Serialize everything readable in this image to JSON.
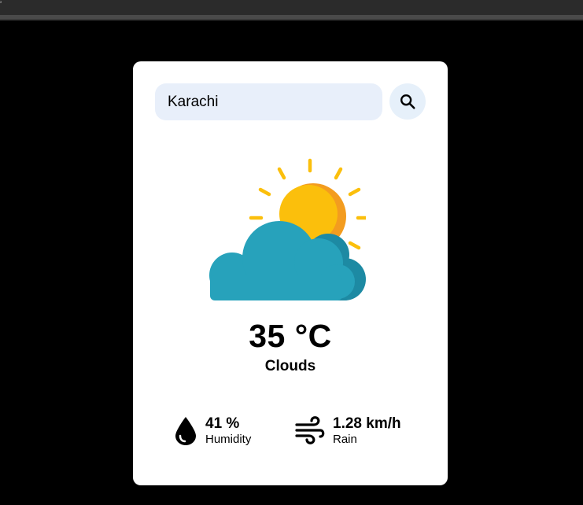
{
  "search": {
    "value": "Karachi",
    "icon": "search-icon"
  },
  "weather": {
    "icon": "sun-behind-cloud-icon",
    "temperature": "35 °C",
    "condition": "Clouds"
  },
  "details": {
    "humidity": {
      "icon": "water-drop-icon",
      "value": "41 %",
      "label": "Humidity"
    },
    "wind": {
      "icon": "wind-icon",
      "value": "1.28 km/h",
      "label": "Rain"
    }
  },
  "colors": {
    "page_background": "#000000",
    "card_background": "#ffffff",
    "search_background": "#e8effa",
    "sun": "#fbbf0c",
    "sun_shade": "#f39c1f",
    "cloud": "#27a2bb",
    "cloud_shade": "#1d8aa3"
  }
}
